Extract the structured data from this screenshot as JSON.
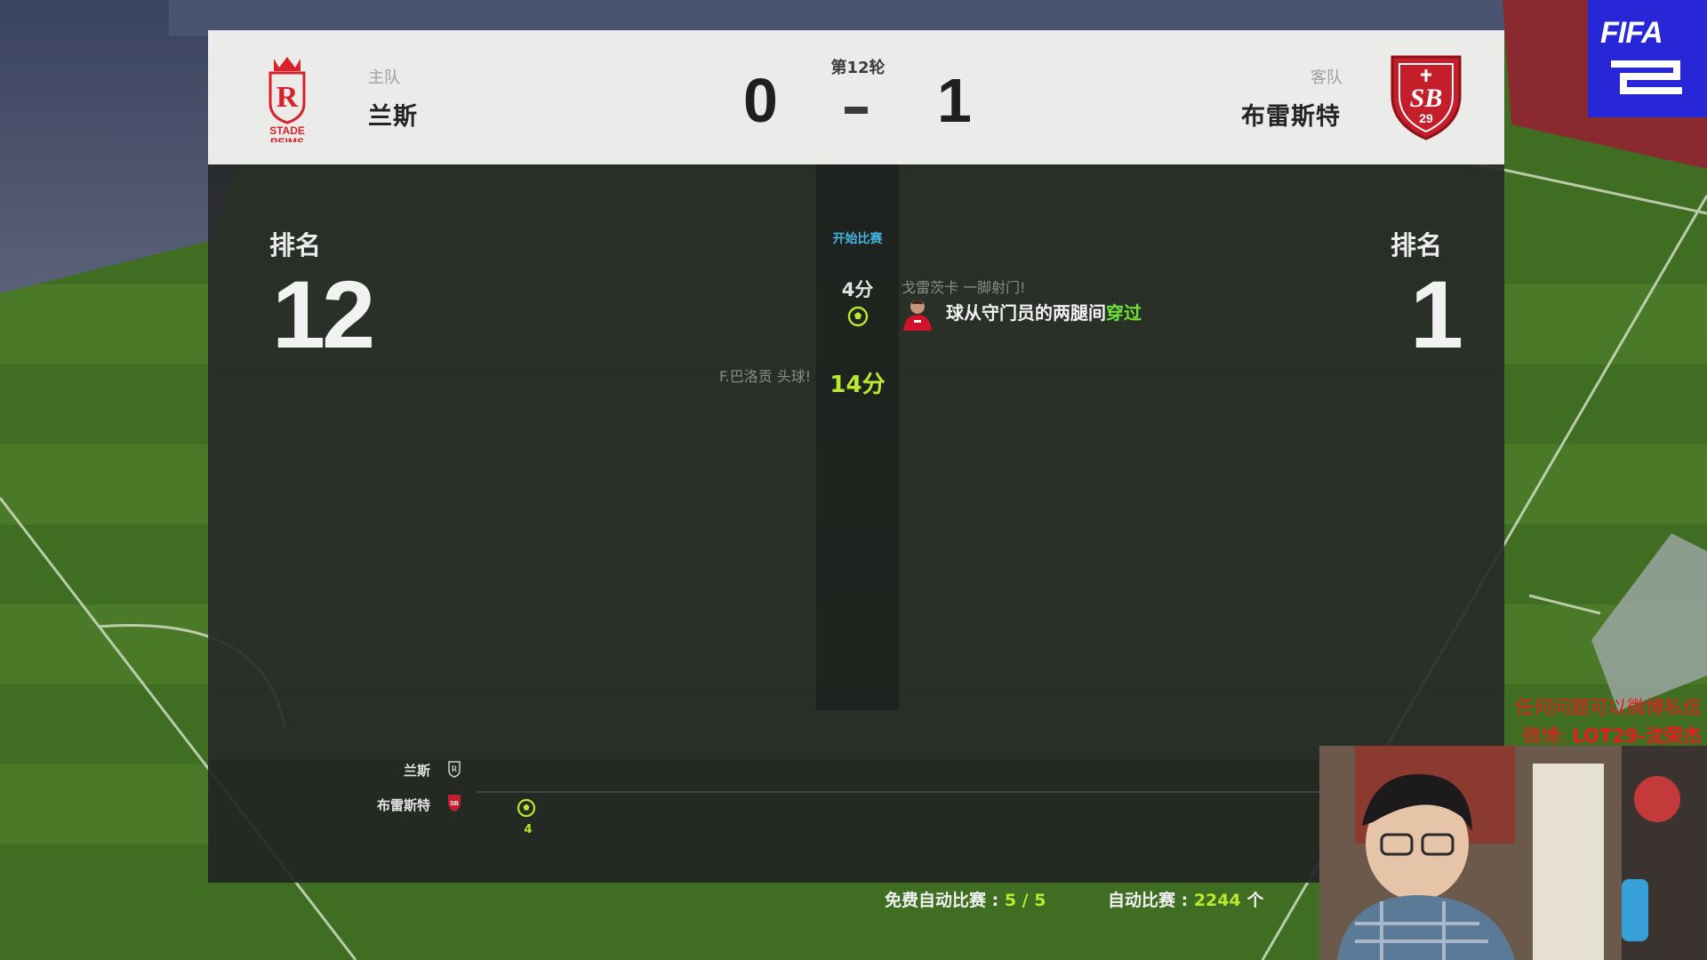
{
  "header": {
    "home_side_label": "主队",
    "home_team": "兰斯",
    "home_crest_text": "STADE REIMS",
    "away_side_label": "客队",
    "away_team": "布雷斯特",
    "away_crest_text": "SB 29",
    "round": "第12轮",
    "home_score": "0",
    "away_score": "1"
  },
  "rank": {
    "home_label": "排名",
    "home_value": "12",
    "away_label": "排名",
    "away_value": "1"
  },
  "events": {
    "start_label": "开始比赛",
    "away_goal": {
      "minute": "4分",
      "subtitle": "戈雷茨卡 一脚射门!",
      "text_before": "球从守门员的两腿间",
      "text_highlight": "穿过"
    },
    "home_event": {
      "minute": "14分",
      "subtitle": "F.巴洛贡 头球!"
    }
  },
  "timeline": {
    "home_team": "兰斯",
    "away_team": "布雷斯特",
    "goal_minute": "4"
  },
  "footer": {
    "free_auto_label": "免费自动比赛 : ",
    "free_auto_value": "5 / 5",
    "auto_label": "自动比赛 : ",
    "auto_value": "2244",
    "auto_unit": " 个"
  },
  "brand": {
    "logo_text": "FIFA"
  },
  "stream_overlay": {
    "line1": "任何问题可以微博私信",
    "line2_prefix": "微博: ",
    "line2_handle": "LOT29-沈荣杰"
  },
  "colors": {
    "accent_green": "#b9ea2e",
    "goal_highlight": "#6ee03a",
    "start_blue": "#45b3e0",
    "fifa_blue": "#2727d8",
    "overlay_red": "#e61e1e"
  }
}
